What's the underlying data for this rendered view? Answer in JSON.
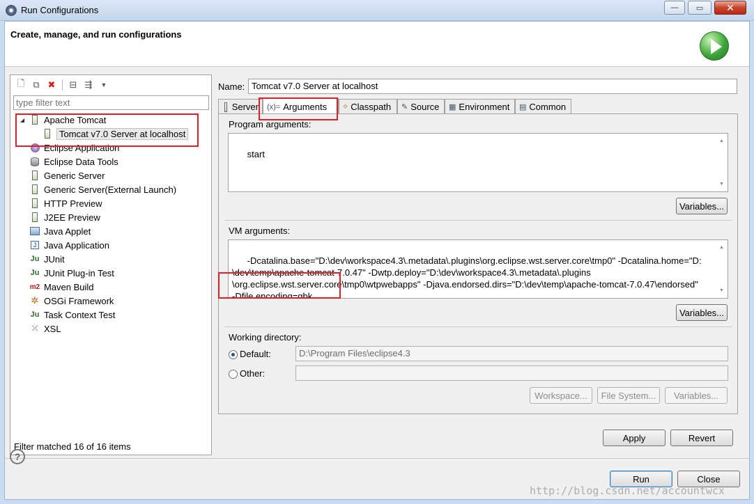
{
  "window": {
    "title": "Run Configurations",
    "close_glyph": "✕",
    "min_glyph": "—",
    "max_glyph": "▭"
  },
  "header": {
    "title": "Create, manage, and run configurations",
    "icon": "run-icon"
  },
  "left": {
    "filter_placeholder": "type filter text",
    "tree": [
      {
        "label": "Apache Tomcat",
        "icon": "server-icon",
        "expanded": true,
        "depth": 0
      },
      {
        "label": "Tomcat v7.0 Server at localhost",
        "icon": "server-icon",
        "depth": 1,
        "selected": true
      },
      {
        "label": "Eclipse Application",
        "icon": "eclipse-icon",
        "depth": 0
      },
      {
        "label": "Eclipse Data Tools",
        "icon": "database-icon",
        "depth": 0
      },
      {
        "label": "Generic Server",
        "icon": "server-icon",
        "depth": 0
      },
      {
        "label": "Generic Server(External Launch)",
        "icon": "server-icon",
        "depth": 0
      },
      {
        "label": "HTTP Preview",
        "icon": "server-icon",
        "depth": 0
      },
      {
        "label": "J2EE Preview",
        "icon": "server-icon",
        "depth": 0
      },
      {
        "label": "Java Applet",
        "icon": "applet-icon",
        "depth": 0
      },
      {
        "label": "Java Application",
        "icon": "java-app-icon",
        "depth": 0
      },
      {
        "label": "JUnit",
        "icon": "junit-icon",
        "depth": 0
      },
      {
        "label": "JUnit Plug-in Test",
        "icon": "junit-icon",
        "depth": 0
      },
      {
        "label": "Maven Build",
        "icon": "maven-icon",
        "depth": 0
      },
      {
        "label": "OSGi Framework",
        "icon": "osgi-icon",
        "depth": 0
      },
      {
        "label": "Task Context Test",
        "icon": "junit-icon",
        "depth": 0
      },
      {
        "label": "XSL",
        "icon": "xsl-icon",
        "depth": 0
      }
    ],
    "status": "Filter matched 16 of 16 items"
  },
  "name": {
    "label": "Name:",
    "value": "Tomcat v7.0 Server at localhost"
  },
  "tabs": [
    {
      "label": "Server",
      "icon": "server-icon"
    },
    {
      "label": "Arguments",
      "icon": "arguments-icon",
      "active": true
    },
    {
      "label": "Classpath",
      "icon": "classpath-icon"
    },
    {
      "label": "Source",
      "icon": "source-icon"
    },
    {
      "label": "Environment",
      "icon": "environment-icon"
    },
    {
      "label": "Common",
      "icon": "common-icon"
    }
  ],
  "program_args": {
    "label": "Program arguments:",
    "value": "start",
    "variables_label": "Variables..."
  },
  "vm_args": {
    "label": "VM arguments:",
    "value": "-Dcatalina.base=\"D:\\dev\\workspace4.3\\.metadata\\.plugins\\org.eclipse.wst.server.core\\tmp0\" -Dcatalina.home=\"D:\n\\dev\\temp\\apache-tomcat-7.0.47\" -Dwtp.deploy=\"D:\\dev\\workspace4.3\\.metadata\\.plugins\n\\org.eclipse.wst.server.core\\tmp0\\wtpwebapps\" -Djava.endorsed.dirs=\"D:\\dev\\temp\\apache-tomcat-7.0.47\\endorsed\"\n-Dfile.encoding=gbk",
    "variables_label": "Variables..."
  },
  "working_dir": {
    "label": "Working directory:",
    "default_label": "Default:",
    "default_value": "D:\\Program Files\\eclipse4.3",
    "other_label": "Other:",
    "other_value": "",
    "workspace_label": "Workspace...",
    "filesystem_label": "File System...",
    "variables_label": "Variables..."
  },
  "actions": {
    "apply": "Apply",
    "revert": "Revert",
    "run": "Run",
    "close": "Close"
  },
  "watermark": "http://blog.csdn.net/accountwcx",
  "highlight_color": "#e41e26"
}
